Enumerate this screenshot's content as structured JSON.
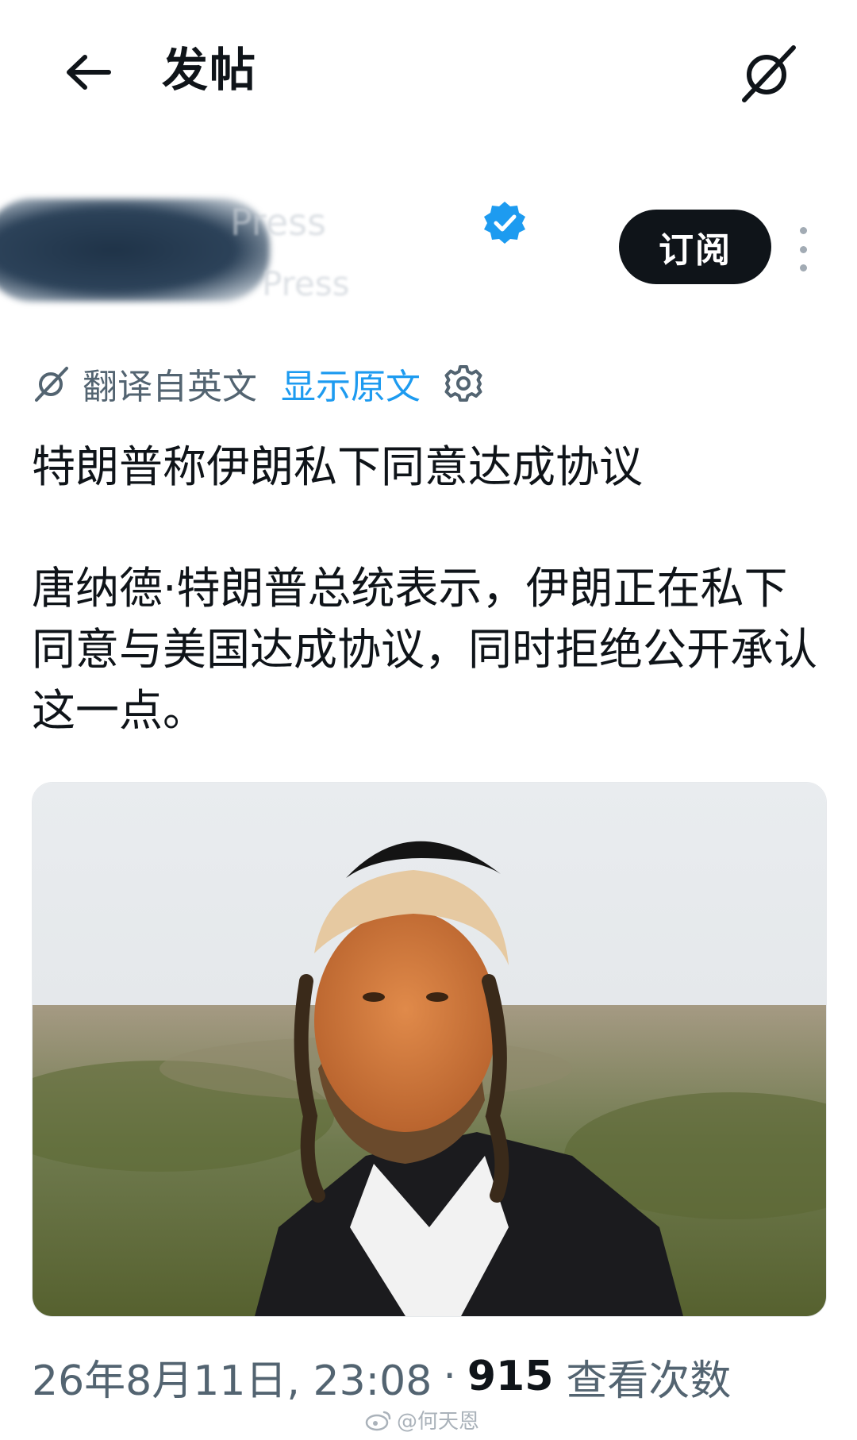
{
  "header": {
    "title": "发帖"
  },
  "author": {
    "display_name": "Press",
    "handle": "Press",
    "subscribe_label": "订阅"
  },
  "translation": {
    "label": "翻译自英文",
    "show_original": "显示原文"
  },
  "post": {
    "title": "特朗普称伊朗私下同意达成协议",
    "body": "唐纳德·特朗普总统表示，伊朗正在私下同意与美国达成协议，同时拒绝公开承认这一点。"
  },
  "meta": {
    "timestamp": "26年8月11日, 23:08",
    "separator": "·",
    "views": "915",
    "views_label": "查看次数"
  },
  "watermark": {
    "text": "@何天恩"
  },
  "colors": {
    "text": "#0f1419",
    "secondary": "#536471",
    "link": "#1d9bf0",
    "verified": "#1d9bf0",
    "button": "#0f1419"
  }
}
